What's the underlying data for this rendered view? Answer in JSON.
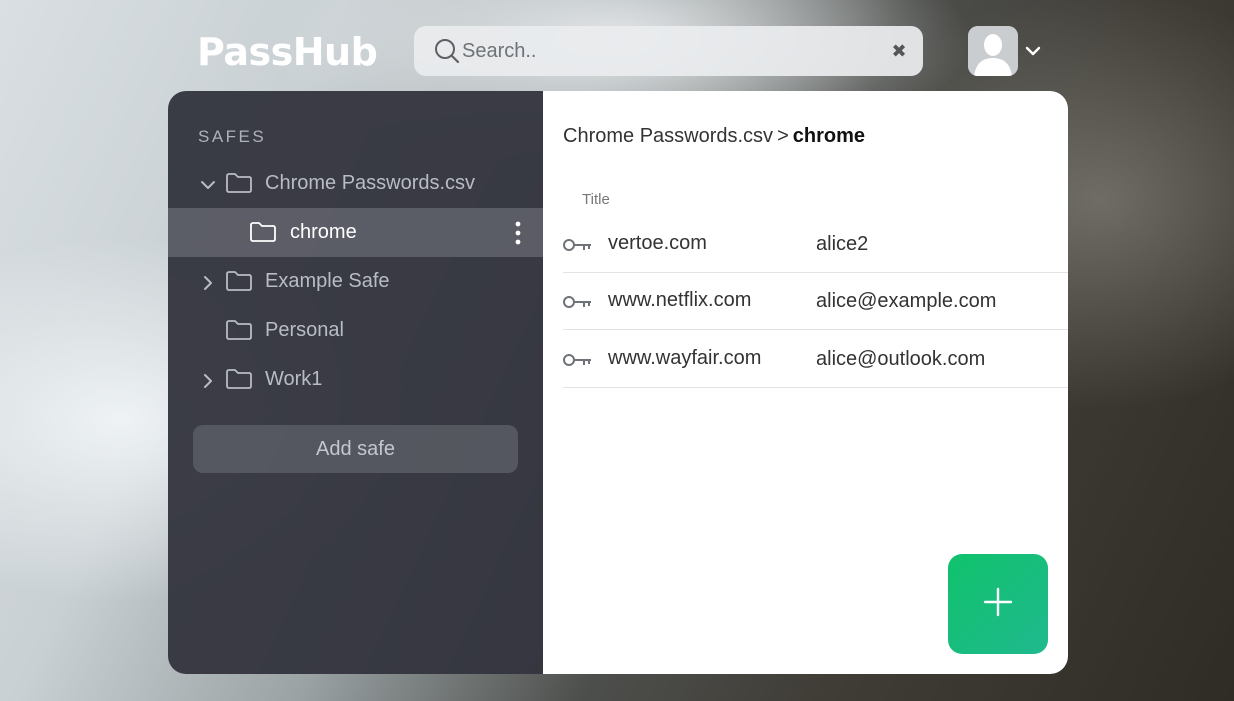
{
  "header": {
    "logo": "PassHub",
    "search_placeholder": "Search.."
  },
  "sidebar": {
    "section_label": "SAFES",
    "items": [
      {
        "label": "Chrome Passwords.csv",
        "expanded": true
      },
      {
        "label": "chrome",
        "active": true
      },
      {
        "label": "Example Safe",
        "expanded": false
      },
      {
        "label": "Personal"
      },
      {
        "label": "Work1",
        "expanded": false
      }
    ],
    "add_safe_label": "Add safe"
  },
  "content": {
    "breadcrumb": {
      "parent": "Chrome Passwords.csv",
      "separator": ">",
      "current": "chrome"
    },
    "column_title": "Title",
    "rows": [
      {
        "title": "vertoe.com",
        "username": "alice2"
      },
      {
        "title": "www.netflix.com",
        "username": "alice@example.com"
      },
      {
        "title": "www.wayfair.com",
        "username": "alice@outlook.com"
      }
    ]
  },
  "icons": {
    "search": "search-icon",
    "clear": "clear-icon",
    "avatar": "avatar-icon",
    "folder": "folder-icon",
    "key": "key-icon",
    "add": "plus-icon"
  },
  "colors": {
    "accent": "#10c26b",
    "sidebar_bg": "#34353e",
    "active_item_bg": "#5c5e68"
  }
}
